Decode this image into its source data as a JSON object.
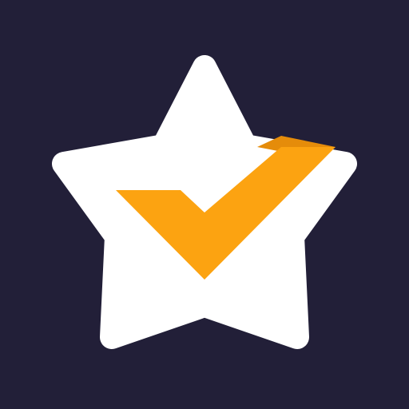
{
  "app_icon": {
    "name": "star-checkmark",
    "colors": {
      "background": "#221f38",
      "star": "#ffffff",
      "check": "#fca311",
      "check_fold": "#e58c0a"
    }
  }
}
